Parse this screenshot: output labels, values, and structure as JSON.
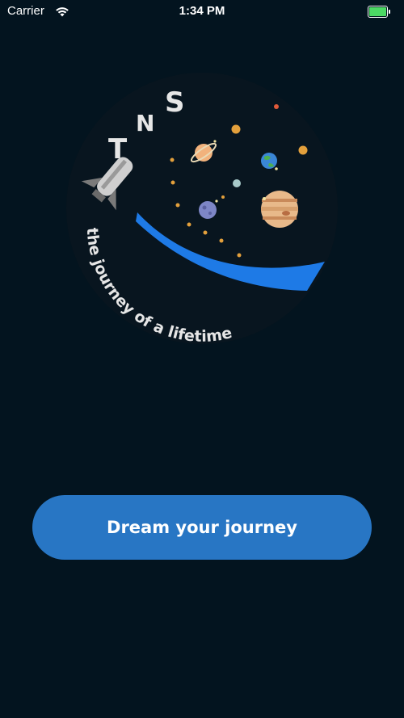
{
  "status_bar": {
    "carrier": "Carrier",
    "time": "1:34 PM",
    "battery_color": "#4cd964"
  },
  "logo": {
    "letters": [
      "T",
      "N",
      "S"
    ],
    "tagline": "the journey of a lifetime",
    "icons": [
      "rocket-icon",
      "saturn-icon",
      "earth-icon",
      "jupiter-icon",
      "planet-icon",
      "moon-icon"
    ]
  },
  "cta": {
    "label": "Dream your journey",
    "color": "#2876c4"
  },
  "colors": {
    "background": "#03141f",
    "trail": "#1e7ae6"
  }
}
